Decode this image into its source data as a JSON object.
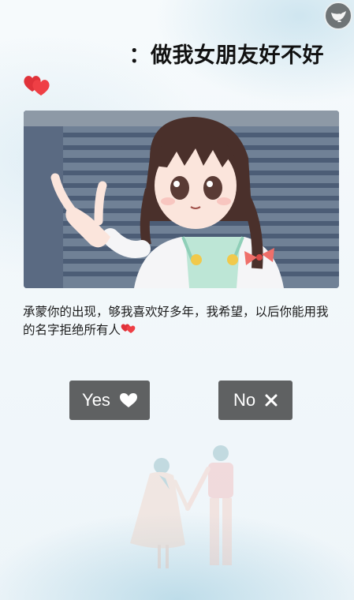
{
  "page": {
    "title": "：做我女朋友好不好",
    "message": "承蒙你的出现，够我喜欢好多年，我希望，以后你能用我的名字拒绝所有人"
  },
  "buttons": {
    "yes_label": "Yes",
    "no_label": "No"
  },
  "icons": {
    "music": "music-disc-icon",
    "hearts": "double-heart-icon",
    "yes": "heart-icon",
    "no": "close-icon"
  },
  "colors": {
    "button_bg": "#5f6162",
    "heart_red": "#e0323a"
  }
}
